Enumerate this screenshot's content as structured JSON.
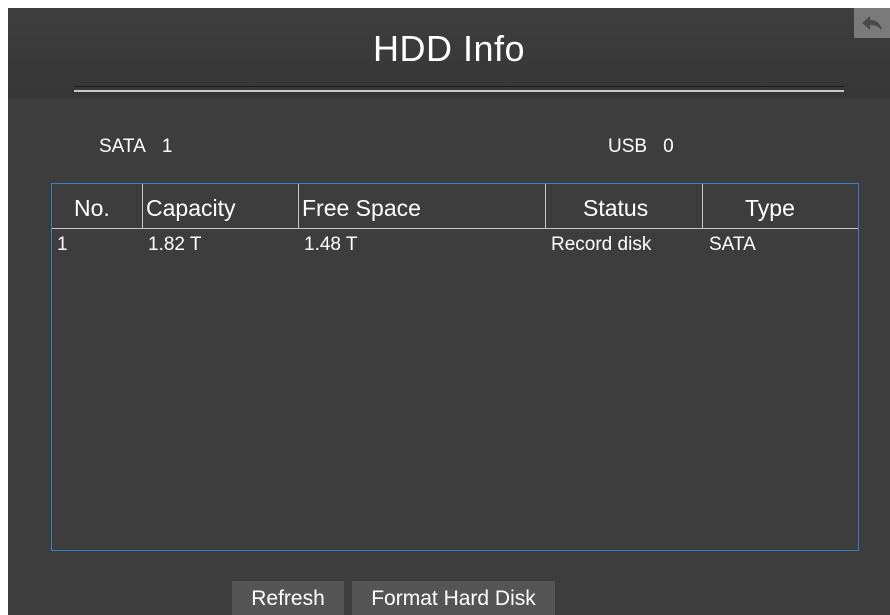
{
  "window": {
    "title": "HDD Info"
  },
  "summary": {
    "sata_label": "SATA",
    "sata_count": "1",
    "usb_label": "USB",
    "usb_count": "0"
  },
  "table": {
    "columns": [
      "No.",
      "Capacity",
      "Free Space",
      "Status",
      "Type"
    ],
    "rows": [
      {
        "no": "1",
        "capacity": "1.82 T",
        "free_space": "1.48 T",
        "status": "Record disk",
        "type": "SATA"
      }
    ]
  },
  "actions": {
    "refresh_label": "Refresh",
    "format_label": "Format Hard Disk"
  },
  "icons": {
    "back": "back-arrow-icon"
  },
  "colors": {
    "background": "#3d3d3d",
    "table_border": "#3a7fc1",
    "text": "#ffffff",
    "button": "#555555"
  }
}
